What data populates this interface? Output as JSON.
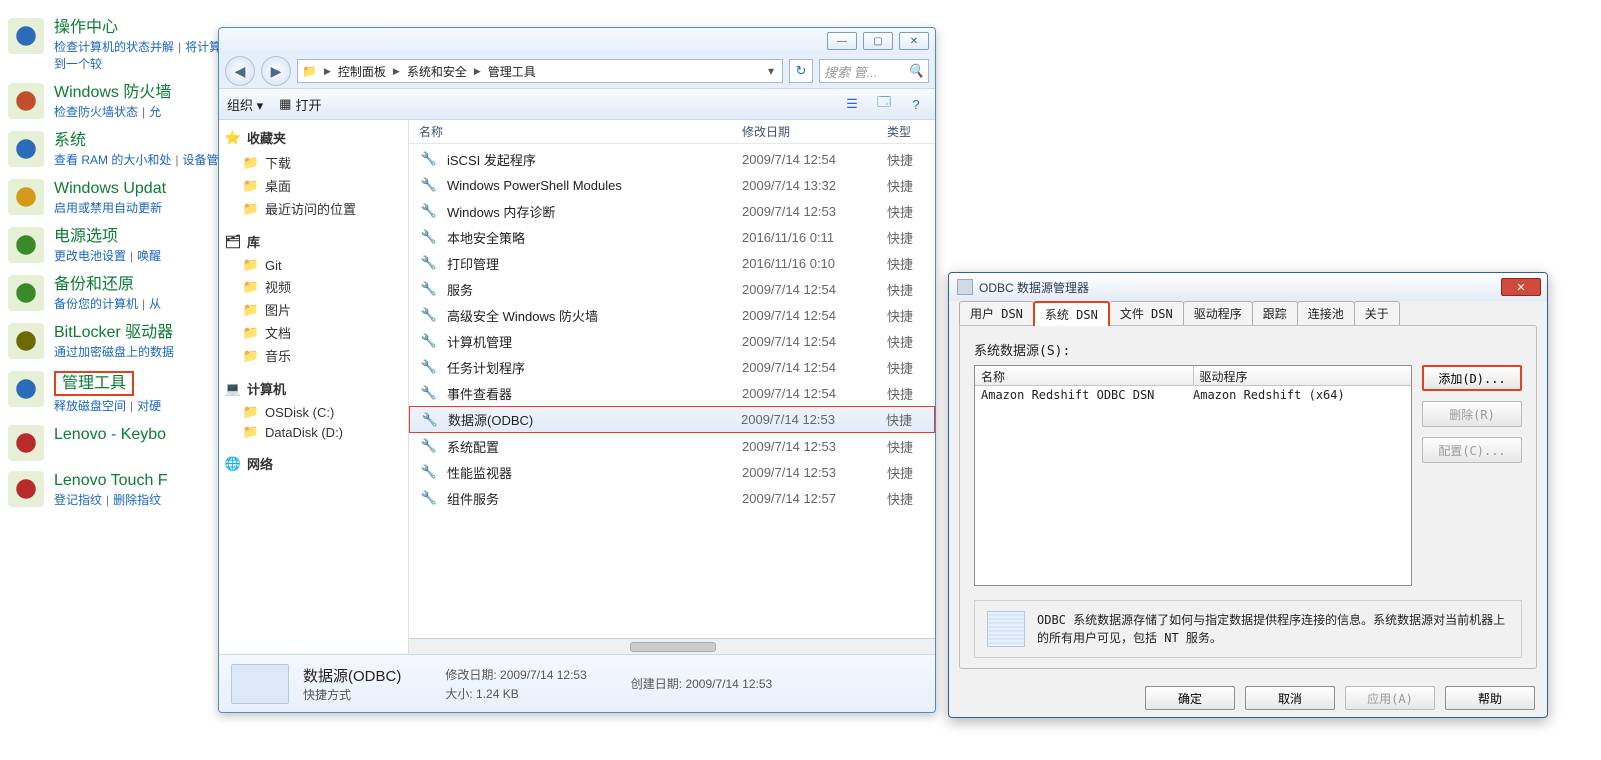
{
  "control_panel": {
    "categories": [
      {
        "title": "操作中心",
        "links": [
          "检查计算机的状态并解",
          "将计算机还原到一个较"
        ],
        "icon": "flag"
      },
      {
        "title": "Windows 防火墙",
        "links": [
          "检查防火墙状态",
          "允"
        ],
        "icon": "firewall"
      },
      {
        "title": "系统",
        "links": [
          "查看 RAM 的大小和处",
          "设备管理器"
        ],
        "icon": "system"
      },
      {
        "title": "Windows Updat",
        "links": [
          "启用或禁用自动更新"
        ],
        "icon": "update"
      },
      {
        "title": "电源选项",
        "links": [
          "更改电池设置",
          "唤醒"
        ],
        "icon": "power"
      },
      {
        "title": "备份和还原",
        "links": [
          "备份您的计算机",
          "从"
        ],
        "icon": "backup"
      },
      {
        "title": "BitLocker 驱动器",
        "links": [
          "通过加密磁盘上的数据"
        ],
        "icon": "bitlocker"
      },
      {
        "title": "管理工具",
        "links": [
          "释放磁盘空间",
          "对硬"
        ],
        "icon": "admintools",
        "highlight": true
      },
      {
        "title": "Lenovo - Keybo",
        "links": [],
        "icon": "keyboard"
      },
      {
        "title": "Lenovo Touch F",
        "links": [
          "登记指纹",
          "删除指纹"
        ],
        "icon": "touch"
      }
    ]
  },
  "explorer": {
    "window_buttons": {
      "min": "—",
      "max": "▢",
      "close": "✕"
    },
    "nav": {
      "back": "◀",
      "forward": "▶"
    },
    "breadcrumbs": [
      "控制面板",
      "系统和安全",
      "管理工具"
    ],
    "refresh": "↻",
    "search_placeholder": "搜索 管...",
    "cmdbar": {
      "organize": "组织 ▾",
      "open": "打开",
      "view_icon": "☰",
      "preview_icon": "🗔",
      "help_icon": "?"
    },
    "tree": {
      "favorites": {
        "label": "收藏夹",
        "items": [
          "下载",
          "桌面",
          "最近访问的位置"
        ]
      },
      "libraries": {
        "label": "库",
        "items": [
          "Git",
          "视频",
          "图片",
          "文档",
          "音乐"
        ]
      },
      "computer": {
        "label": "计算机",
        "items": [
          "OSDisk (C:)",
          "DataDisk (D:)"
        ]
      },
      "network": {
        "label": "网络",
        "items": []
      }
    },
    "columns": {
      "name": "名称",
      "date": "修改日期",
      "type": "类型"
    },
    "rows": [
      {
        "name": "iSCSI 发起程序",
        "date": "2009/7/14 12:54",
        "type": "快捷"
      },
      {
        "name": "Windows PowerShell Modules",
        "date": "2009/7/14 13:32",
        "type": "快捷"
      },
      {
        "name": "Windows 内存诊断",
        "date": "2009/7/14 12:53",
        "type": "快捷"
      },
      {
        "name": "本地安全策略",
        "date": "2016/11/16 0:11",
        "type": "快捷"
      },
      {
        "name": "打印管理",
        "date": "2016/11/16 0:10",
        "type": "快捷"
      },
      {
        "name": "服务",
        "date": "2009/7/14 12:54",
        "type": "快捷"
      },
      {
        "name": "高级安全 Windows 防火墙",
        "date": "2009/7/14 12:54",
        "type": "快捷"
      },
      {
        "name": "计算机管理",
        "date": "2009/7/14 12:54",
        "type": "快捷"
      },
      {
        "name": "任务计划程序",
        "date": "2009/7/14 12:54",
        "type": "快捷"
      },
      {
        "name": "事件查看器",
        "date": "2009/7/14 12:54",
        "type": "快捷"
      },
      {
        "name": "数据源(ODBC)",
        "date": "2009/7/14 12:53",
        "type": "快捷",
        "selected": true
      },
      {
        "name": "系统配置",
        "date": "2009/7/14 12:53",
        "type": "快捷"
      },
      {
        "name": "性能监视器",
        "date": "2009/7/14 12:53",
        "type": "快捷"
      },
      {
        "name": "组件服务",
        "date": "2009/7/14 12:57",
        "type": "快捷"
      }
    ],
    "details": {
      "title": "数据源(ODBC)",
      "subtitle": "快捷方式",
      "modified_label": "修改日期:",
      "modified_value": "2009/7/14 12:53",
      "size_label": "大小:",
      "size_value": "1.24 KB",
      "created_label": "创建日期:",
      "created_value": "2009/7/14 12:53"
    }
  },
  "odbc": {
    "title": "ODBC 数据源管理器",
    "tabs": [
      "用户 DSN",
      "系统 DSN",
      "文件 DSN",
      "驱动程序",
      "跟踪",
      "连接池",
      "关于"
    ],
    "active_tab_index": 1,
    "list_label": "系统数据源(S):",
    "headers": {
      "name": "名称",
      "driver": "驱动程序"
    },
    "rows": [
      {
        "name": "Amazon Redshift ODBC DSN",
        "driver": "Amazon Redshift (x64)"
      }
    ],
    "buttons": {
      "add": "添加(D)...",
      "remove": "删除(R)",
      "configure": "配置(C)..."
    },
    "info_text": "ODBC 系统数据源存储了如何与指定数据提供程序连接的信息。系统数据源对当前机器上的所有用户可见，包括 NT 服务。",
    "footer": {
      "ok": "确定",
      "cancel": "取消",
      "apply": "应用(A)",
      "help": "帮助"
    }
  }
}
